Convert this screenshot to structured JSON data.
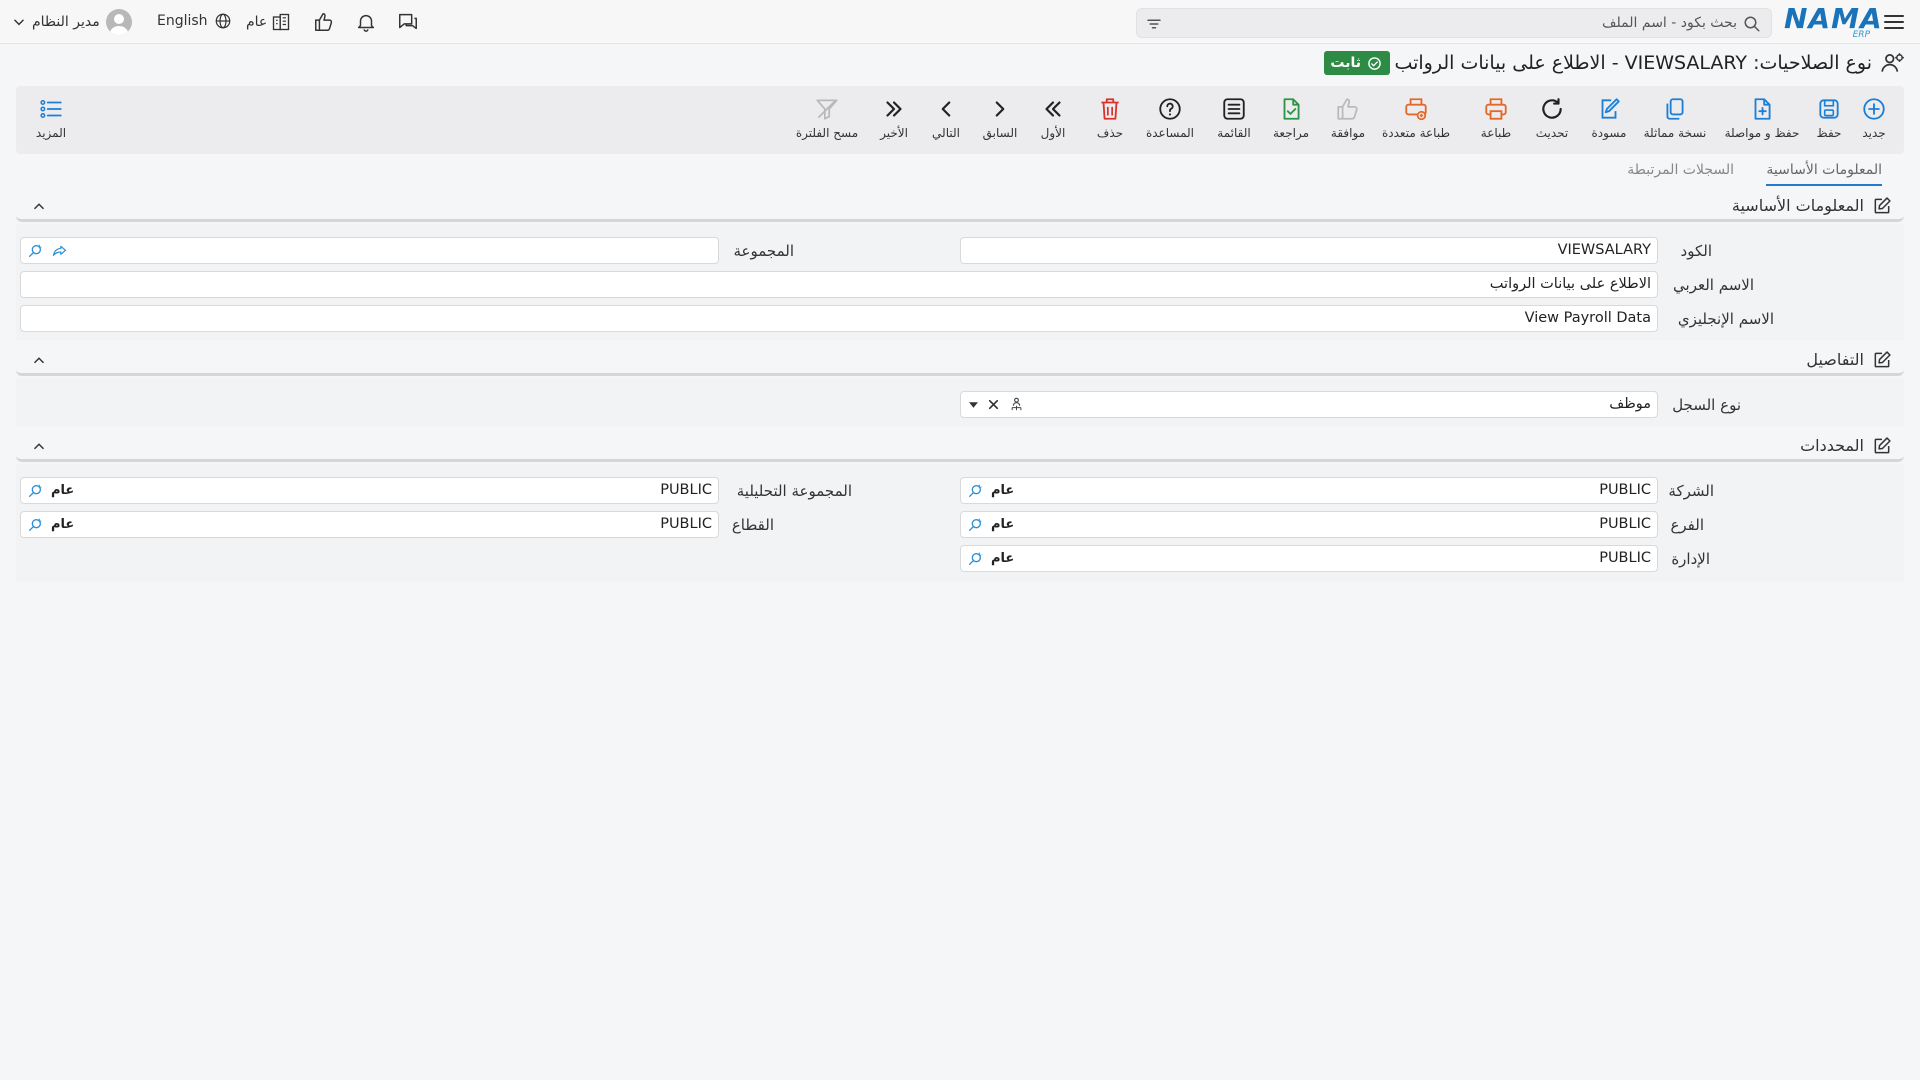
{
  "header": {
    "logo": "NAMA",
    "logo_sub": "ERP",
    "search_placeholder": "بحث بكود - اسم الملف",
    "public_label": "عام",
    "language": "English",
    "user_name": "مدير النظام"
  },
  "title": {
    "text": "نوع الصلاحيات: VIEWSALARY - الاطلاع على بيانات الرواتب",
    "status": "ثابت"
  },
  "toolbar": {
    "new": "جديد",
    "save": "حفظ",
    "save_continue": "حفظ و مواصلة",
    "duplicate": "نسخة مماثلة",
    "draft": "مسودة",
    "refresh": "تحديث",
    "print": "طباعة",
    "multi_print": "طباعة متعددة",
    "approve": "موافقة",
    "review": "مراجعة",
    "list": "القائمة",
    "help": "المساعدة",
    "delete": "حذف",
    "first": "الأول",
    "previous": "السابق",
    "next": "التالي",
    "last": "الأخير",
    "clear_filter": "مسح الفلترة",
    "more": "المزيد"
  },
  "tabs": {
    "basic": "المعلومات الأساسية",
    "related": "السجلات المرتبطة"
  },
  "basic_section": {
    "title": "المعلومات الأساسية",
    "code_label": "الكود",
    "code_value": "VIEWSALARY",
    "group_label": "المجموعة",
    "group_value": "",
    "arabic_name_label": "الاسم العربي",
    "arabic_name_value": "الاطلاع على بيانات الرواتب",
    "english_name_label": "الاسم الإنجليزي",
    "english_name_value": "View Payroll Data"
  },
  "details_section": {
    "title": "التفاصيل",
    "record_type_label": "نوع السجل",
    "record_type_value": "موظف"
  },
  "dimensions_section": {
    "title": "المحددات",
    "company_label": "الشركة",
    "company_value": "PUBLIC",
    "company_tag": "عام",
    "analytic_group_label": "المجموعة التحليلية",
    "analytic_group_value": "PUBLIC",
    "analytic_group_tag": "عام",
    "branch_label": "الفرع",
    "branch_value": "PUBLIC",
    "branch_tag": "عام",
    "sector_label": "القطاع",
    "sector_value": "PUBLIC",
    "sector_tag": "عام",
    "department_label": "الإدارة",
    "department_value": "PUBLIC",
    "department_tag": "عام"
  },
  "colors": {
    "accent": "#1c7fd6",
    "status_green": "#2e8b45",
    "print_orange": "#e3692a",
    "delete_red": "#d9342b"
  }
}
